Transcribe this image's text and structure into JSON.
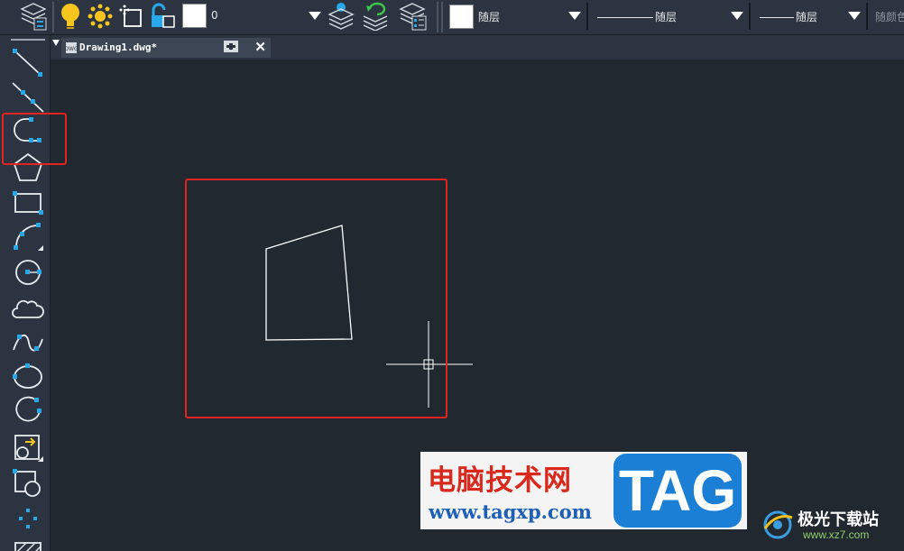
{
  "toolbar": {
    "layer_current": "0",
    "color_value": "随层",
    "linetype_value": "随层",
    "lineweight_value": "随层",
    "plotstyle_value": "随颜色"
  },
  "tab": {
    "file_name": "Drawing1.dwg*",
    "close_glyph": "✕"
  },
  "left_tools": [
    "line-tool",
    "construction-line-tool",
    "polyline-tool",
    "polygon-tool",
    "rectangle-tool",
    "arc-tool",
    "circle-tool",
    "revision-cloud-tool",
    "spline-tool",
    "ellipse-tool",
    "ellipse-arc-tool",
    "insert-block-tool",
    "make-block-tool",
    "point-tool",
    "hatch-tool"
  ],
  "watermarks": {
    "site_cn": "电脑技术网",
    "site_url": "www.tagxp.com",
    "logo_text": "TAG",
    "partner_cn": "极光下载站",
    "partner_url": "www.xz7.com"
  },
  "colors": {
    "toolbar_bg": "#2b3440",
    "canvas_bg": "#212830",
    "highlight": "#e0241f",
    "tool_accent": "#28a8e8"
  }
}
